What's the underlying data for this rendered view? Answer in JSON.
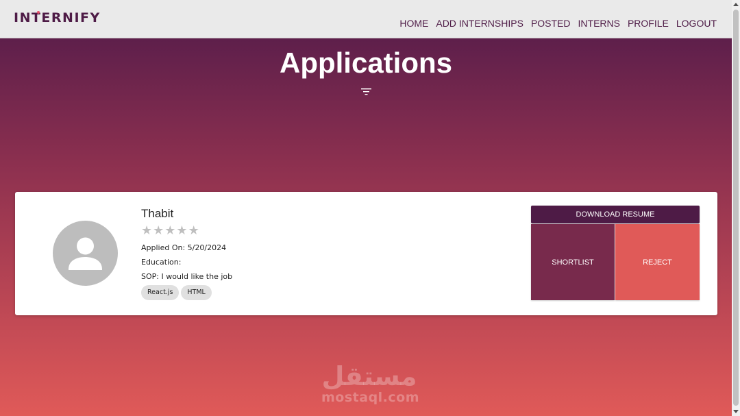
{
  "navbar": {
    "logo": "INTERNIFY",
    "links": [
      "HOME",
      "ADD INTERNSHIPS",
      "POSTED",
      "INTERNS",
      "PROFILE",
      "LOGOUT"
    ]
  },
  "page": {
    "title": "Applications",
    "filter_icon": "filter-list-icon"
  },
  "application": {
    "name": "Thabit",
    "rating": 0,
    "rating_max": 5,
    "applied_on": "Applied On: 5/20/2024",
    "education": "Education:",
    "sop": "SOP: I would like the job",
    "skills": [
      "React.js",
      "HTML"
    ],
    "buttons": {
      "download": "DOWNLOAD RESUME",
      "shortlist": "SHORTLIST",
      "reject": "REJECT"
    }
  },
  "watermark": {
    "arabic": "مستقل",
    "latin": "mostaql.com"
  },
  "colors": {
    "brand": "#4e1b46",
    "shortlist": "#782a4c",
    "reject": "#e05a58",
    "logo_dot": "#e8546b"
  }
}
